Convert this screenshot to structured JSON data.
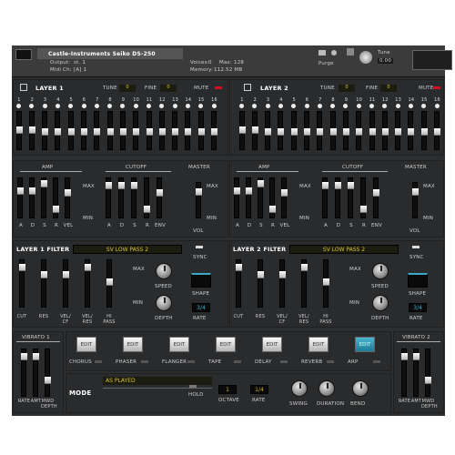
{
  "header": {
    "title": "Castle-Instruments Seiko DS-250",
    "output_label": "Output:",
    "output_value": "st. 1",
    "midi_label": "Midi Ch:",
    "midi_value": "[A] 1",
    "voices_label": "Voices:",
    "voices_value": "0",
    "max_label": "Max:",
    "max_value": "128",
    "memory_label": "Memory:",
    "memory_value": "112.52 MB",
    "purge_label": "Purge",
    "tune_label": "Tune",
    "tune_value": "0.00"
  },
  "layer1": {
    "title": "LAYER 1",
    "tune_label": "TUNE",
    "tune_value": "0",
    "fine_label": "FINE",
    "fine_value": "0",
    "mute_label": "MUTE"
  },
  "layer2": {
    "title": "LAYER 2",
    "tune_label": "TUNE",
    "tune_value": "0",
    "fine_label": "FINE",
    "fine_value": "0",
    "mute_label": "MUTE"
  },
  "step_numbers": [
    "1",
    "2",
    "3",
    "4",
    "5",
    "6",
    "7",
    "8",
    "9",
    "10",
    "11",
    "12",
    "13",
    "14",
    "15",
    "16"
  ],
  "env": {
    "amp_label": "AMP",
    "cutoff_label": "CUTOFF",
    "master_label": "MASTER",
    "max_label": "MAX",
    "min_label": "MIN",
    "amp_sliders": [
      "A",
      "D",
      "S",
      "R",
      "VEL"
    ],
    "cutoff_sliders": [
      "A",
      "D",
      "S",
      "R",
      "ENV"
    ],
    "vol_label": "VOL"
  },
  "filter1": {
    "title": "LAYER 1 FILTER",
    "type": "SV LOW PASS 2",
    "sync": "SYNC",
    "speed": "SPEED",
    "shape": "SHAPE",
    "depth": "DEPTH",
    "rate": "RATE",
    "rate_value": "3/4",
    "max": "MAX",
    "min": "MIN",
    "sliders": [
      "CUT",
      "RES",
      "VEL/ CF",
      "VEL/ RES",
      "HI PASS"
    ]
  },
  "filter2": {
    "title": "LAYER 2 FILTER",
    "type": "SV LOW PASS 2",
    "sync": "SYNC",
    "speed": "SPEED",
    "shape": "SHAPE",
    "depth": "DEPTH",
    "rate": "RATE",
    "rate_value": "3/4",
    "max": "MAX",
    "min": "MIN",
    "sliders": [
      "CUT",
      "RES",
      "VEL/ CF",
      "VEL/ RES",
      "HI PASS"
    ]
  },
  "vibrato1": {
    "title": "VIBRATO 1",
    "labels": [
      "RATE",
      "AMT",
      "MWD DEPTH"
    ]
  },
  "vibrato2": {
    "title": "VIBRATO 2",
    "labels": [
      "RATE",
      "AMT",
      "MWD DEPTH"
    ]
  },
  "effects": [
    {
      "edit": "EDIT",
      "name": "CHORUS"
    },
    {
      "edit": "EDIT",
      "name": "PHASER"
    },
    {
      "edit": "EDIT",
      "name": "FLANGER"
    },
    {
      "edit": "EDIT",
      "name": "TAPE"
    },
    {
      "edit": "EDIT",
      "name": "DELAY"
    },
    {
      "edit": "EDIT",
      "name": "REVERB"
    },
    {
      "edit": "EDIT",
      "name": "ARP"
    }
  ],
  "mode": {
    "label": "MODE",
    "value": "AS PLAYED",
    "hold": "HOLD",
    "octave_label": "OCTAVE",
    "octave_value": "1",
    "rate_label": "RATE",
    "rate_value": "1/4",
    "swing": "SWING",
    "duration": "DURATION",
    "bend": "BEND"
  }
}
